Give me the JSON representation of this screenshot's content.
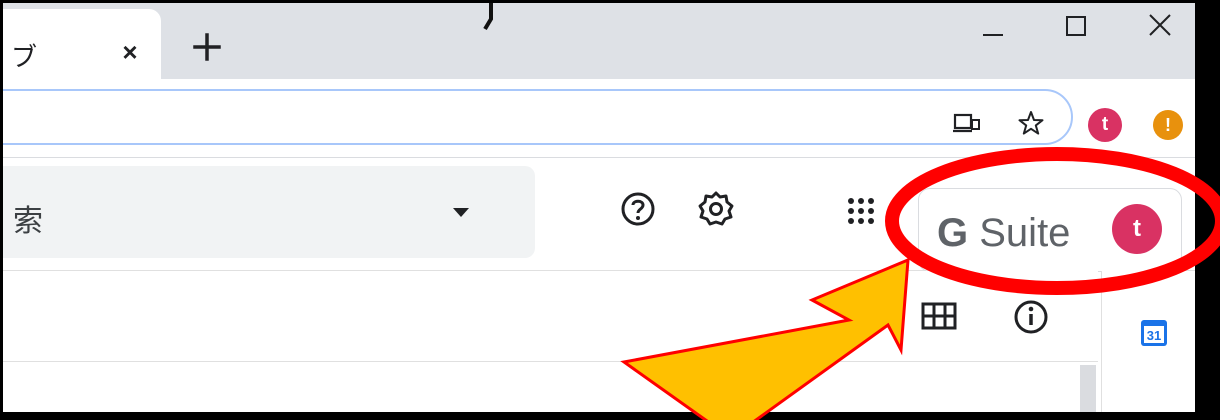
{
  "browser": {
    "tab": {
      "title": "ブ",
      "close_glyph": "×"
    },
    "new_tab_glyph": "+",
    "window_controls": [
      "minimize",
      "maximize",
      "close"
    ],
    "omnibox_icons": [
      "cast-icon",
      "star-icon"
    ],
    "profile_avatar_letter": "t",
    "alert_badge_text": "!"
  },
  "gmail": {
    "search": {
      "text": "索"
    },
    "header_icons": [
      "help-icon",
      "settings-gear-icon",
      "apps-grid-icon"
    ],
    "gsuite": {
      "g_letter": "G",
      "label": "Suite",
      "avatar_letter": "t"
    },
    "list_toolbar_icons": [
      "split-pane-icon",
      "info-icon"
    ],
    "side_panel": {
      "calendar_day": "31"
    }
  },
  "annotation": {
    "highlight_color": "#ff0000",
    "arrow_fill": "#ffc000",
    "arrow_stroke": "#ff0000"
  }
}
